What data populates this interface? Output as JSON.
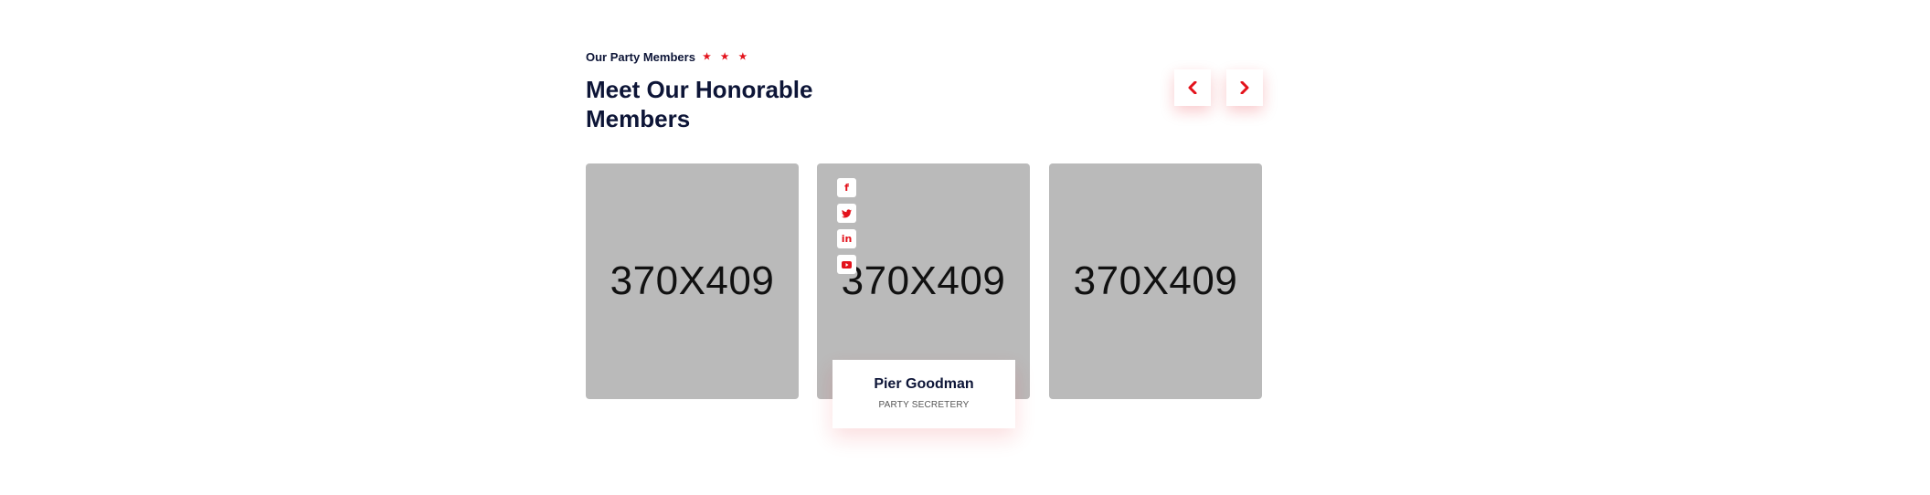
{
  "section": {
    "eyebrow": "Our Party Members",
    "stars": "★ ★ ★",
    "title": "Meet Our Honorable Members"
  },
  "nav": {
    "prev_icon": "chevron-left-icon",
    "next_icon": "chevron-right-icon"
  },
  "members": [
    {
      "placeholder": "370X409"
    },
    {
      "placeholder": "370X409",
      "name": "Pier Goodman",
      "role": "PARTY SECRETERY",
      "socials": [
        "facebook-icon",
        "twitter-icon",
        "linkedin-icon",
        "youtube-icon"
      ]
    },
    {
      "placeholder": "370X409"
    }
  ],
  "colors": {
    "accent": "#e3121b",
    "heading": "#0d1537",
    "placeholder_bg": "#bababa"
  }
}
